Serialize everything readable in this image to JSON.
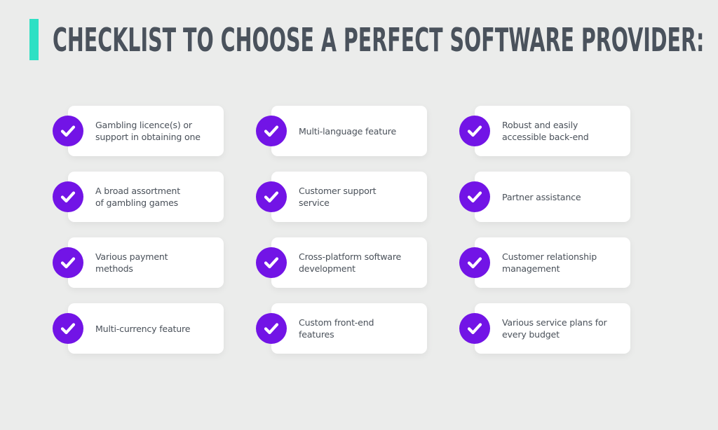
{
  "header": {
    "title": "CHECKLIST TO CHOOSE A PERFECT SOFTWARE PROVIDER:",
    "accent_color": "#2ee0c4"
  },
  "theme": {
    "check_color": "#7214e6",
    "background": "#ebeceb",
    "text_color": "#4a515a"
  },
  "checklist": {
    "columns": [
      {
        "items": [
          {
            "label": "Gambling licence(s) or\nsupport in obtaining one",
            "icon": "check-circle-icon",
            "checked": true
          },
          {
            "label": "A broad assortment\nof gambling games",
            "icon": "check-circle-icon",
            "checked": true
          },
          {
            "label": "Various payment\nmethods",
            "icon": "check-circle-icon",
            "checked": true
          },
          {
            "label": "Multi-currency feature",
            "icon": "check-circle-icon",
            "checked": true
          }
        ]
      },
      {
        "items": [
          {
            "label": "Multi-language feature",
            "icon": "check-circle-icon",
            "checked": true
          },
          {
            "label": "Customer support\nservice",
            "icon": "check-circle-icon",
            "checked": true
          },
          {
            "label": "Cross-platform software\ndevelopment",
            "icon": "check-circle-icon",
            "checked": true
          },
          {
            "label": "Custom front-end\nfeatures",
            "icon": "check-circle-icon",
            "checked": true
          }
        ]
      },
      {
        "items": [
          {
            "label": "Robust and easily\naccessible back-end",
            "icon": "check-circle-icon",
            "checked": true
          },
          {
            "label": "Partner assistance",
            "icon": "check-circle-icon",
            "checked": true
          },
          {
            "label": "Customer relationship\nmanagement",
            "icon": "check-circle-icon",
            "checked": true
          },
          {
            "label": "Various service plans for\nevery budget",
            "icon": "check-circle-icon",
            "checked": true
          }
        ]
      }
    ]
  }
}
